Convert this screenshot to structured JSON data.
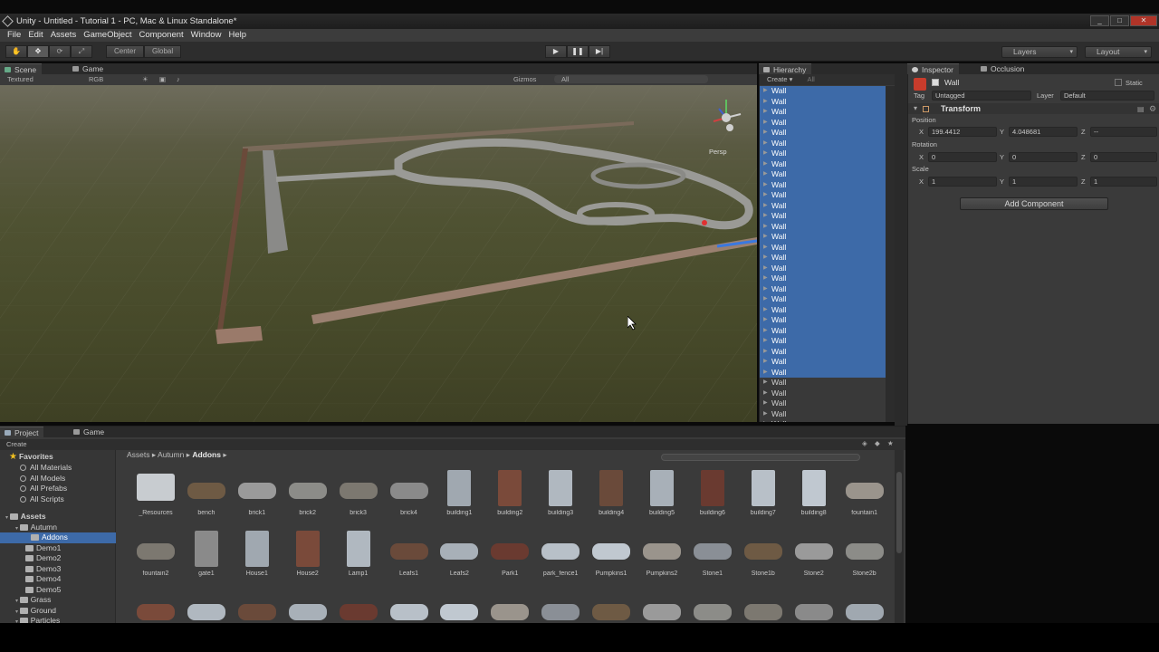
{
  "window": {
    "title": "Unity - Untitled - Tutorial 1 - PC, Mac & Linux Standalone*",
    "buttons": [
      "_",
      "□",
      "✕"
    ]
  },
  "menu": [
    "File",
    "Edit",
    "Assets",
    "GameObject",
    "Component",
    "Window",
    "Help"
  ],
  "toolbar": {
    "tools": [
      "✋",
      "✥",
      "⟳",
      "⤢"
    ],
    "pivot": "Center",
    "space": "Global",
    "play": "▶",
    "pause": "❚❚",
    "step": "▶|",
    "layers": "Layers",
    "layout": "Layout"
  },
  "scene_tabs": {
    "scene": "Scene",
    "game": "Game"
  },
  "scene_bar": {
    "mode": "Textured",
    "color": "RGB",
    "gizmos": "Gizmos",
    "search": "All"
  },
  "scene": {
    "persp": "Persp",
    "gizmo_axes": {
      "x": "x",
      "y": "y",
      "z": "z"
    }
  },
  "hierarchy": {
    "tab": "Hierarchy",
    "create": "Create",
    "search": "All",
    "rows": [
      {
        "name": "Wall",
        "selected": true
      },
      {
        "name": "Wall",
        "selected": true
      },
      {
        "name": "Wall",
        "selected": true
      },
      {
        "name": "Wall",
        "selected": true
      },
      {
        "name": "Wall",
        "selected": true
      },
      {
        "name": "Wall",
        "selected": true
      },
      {
        "name": "Wall",
        "selected": true
      },
      {
        "name": "Wall",
        "selected": true
      },
      {
        "name": "Wall",
        "selected": true
      },
      {
        "name": "Wall",
        "selected": true
      },
      {
        "name": "Wall",
        "selected": true
      },
      {
        "name": "Wall",
        "selected": true
      },
      {
        "name": "Wall",
        "selected": true
      },
      {
        "name": "Wall",
        "selected": true
      },
      {
        "name": "Wall",
        "selected": true
      },
      {
        "name": "Wall",
        "selected": true
      },
      {
        "name": "Wall",
        "selected": true
      },
      {
        "name": "Wall",
        "selected": true
      },
      {
        "name": "Wall",
        "selected": true
      },
      {
        "name": "Wall",
        "selected": true
      },
      {
        "name": "Wall",
        "selected": true
      },
      {
        "name": "Wall",
        "selected": true
      },
      {
        "name": "Wall",
        "selected": true
      },
      {
        "name": "Wall",
        "selected": true
      },
      {
        "name": "Wall",
        "selected": true
      },
      {
        "name": "Wall",
        "selected": true
      },
      {
        "name": "Wall",
        "selected": true
      },
      {
        "name": "Wall",
        "selected": true
      },
      {
        "name": "Wall",
        "selected": false
      },
      {
        "name": "Wall",
        "selected": false
      },
      {
        "name": "Wall",
        "selected": false
      },
      {
        "name": "Wall",
        "selected": false
      },
      {
        "name": "Wall",
        "selected": false
      }
    ]
  },
  "inspector": {
    "tab": "Inspector",
    "tab2": "Occlusion",
    "object_name": "Wall",
    "static": "Static",
    "tag_label": "Tag",
    "tag_value": "Untagged",
    "layer_label": "Layer",
    "layer_value": "Default",
    "component": "Transform",
    "position_label": "Position",
    "rotation_label": "Rotation",
    "scale_label": "Scale",
    "position": {
      "x": "199.4412",
      "y": "4.048681",
      "z": "--"
    },
    "rotation": {
      "x": "0",
      "y": "0",
      "z": "0"
    },
    "scale": {
      "x": "1",
      "y": "1",
      "z": "1"
    },
    "axis": {
      "x": "X",
      "y": "Y",
      "z": "Z"
    },
    "add_component": "Add Component"
  },
  "project": {
    "tab": "Project",
    "tab2": "Game",
    "create": "Create",
    "breadcrumb": [
      "Assets",
      "Autumn",
      "Addons"
    ],
    "favorites": {
      "label": "Favorites",
      "items": [
        "All Materials",
        "All Models",
        "All Prefabs",
        "All Scripts"
      ]
    },
    "tree": [
      {
        "label": "Assets",
        "level": 0,
        "selected": false
      },
      {
        "label": "Autumn",
        "level": 1,
        "selected": false
      },
      {
        "label": "Addons",
        "level": 2,
        "selected": true
      },
      {
        "label": "Demo1",
        "level": 2,
        "selected": false
      },
      {
        "label": "Demo2",
        "level": 2,
        "selected": false
      },
      {
        "label": "Demo3",
        "level": 2,
        "selected": false
      },
      {
        "label": "Demo4",
        "level": 2,
        "selected": false
      },
      {
        "label": "Demo5",
        "level": 2,
        "selected": false
      },
      {
        "label": "Grass",
        "level": 1,
        "selected": false
      },
      {
        "label": "Ground",
        "level": 1,
        "selected": false
      },
      {
        "label": "Particles",
        "level": 1,
        "selected": false
      }
    ],
    "assets_row1": [
      "_Resources",
      "bench",
      "brick1",
      "brick2",
      "brick3",
      "brick4",
      "building1",
      "building2",
      "building3",
      "building4",
      "building5",
      "building6",
      "building7",
      "building8",
      "fountain1"
    ],
    "assets_row2": [
      "fountain2",
      "gate1",
      "House1",
      "House2",
      "Lamp1",
      "Leafs1",
      "Leafs2",
      "Park1",
      "park_fence1",
      "Pumpkins1",
      "Pumpkins2",
      "Stone1",
      "Stone1b",
      "Stone2",
      "Stone2b"
    ],
    "assets_row3_count": 15
  }
}
